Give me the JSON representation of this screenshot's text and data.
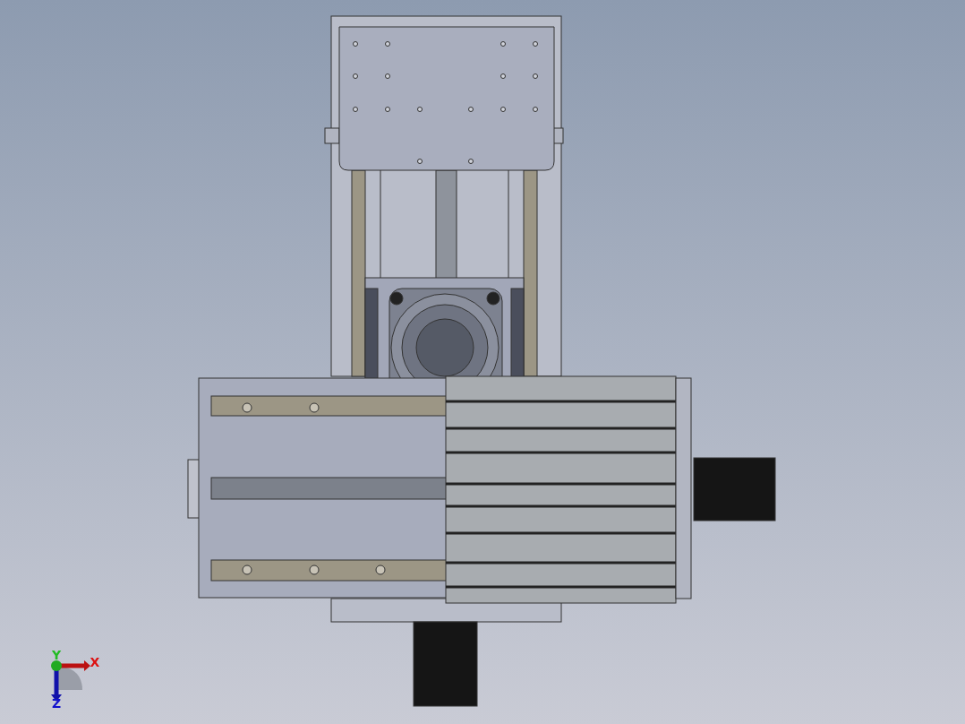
{
  "viewport": {
    "triad": {
      "axes": [
        {
          "label": "Y",
          "color": "#22bb22"
        },
        {
          "label": "X",
          "color": "#dd1111"
        },
        {
          "label": "Z",
          "color": "#1111cc"
        }
      ]
    }
  }
}
